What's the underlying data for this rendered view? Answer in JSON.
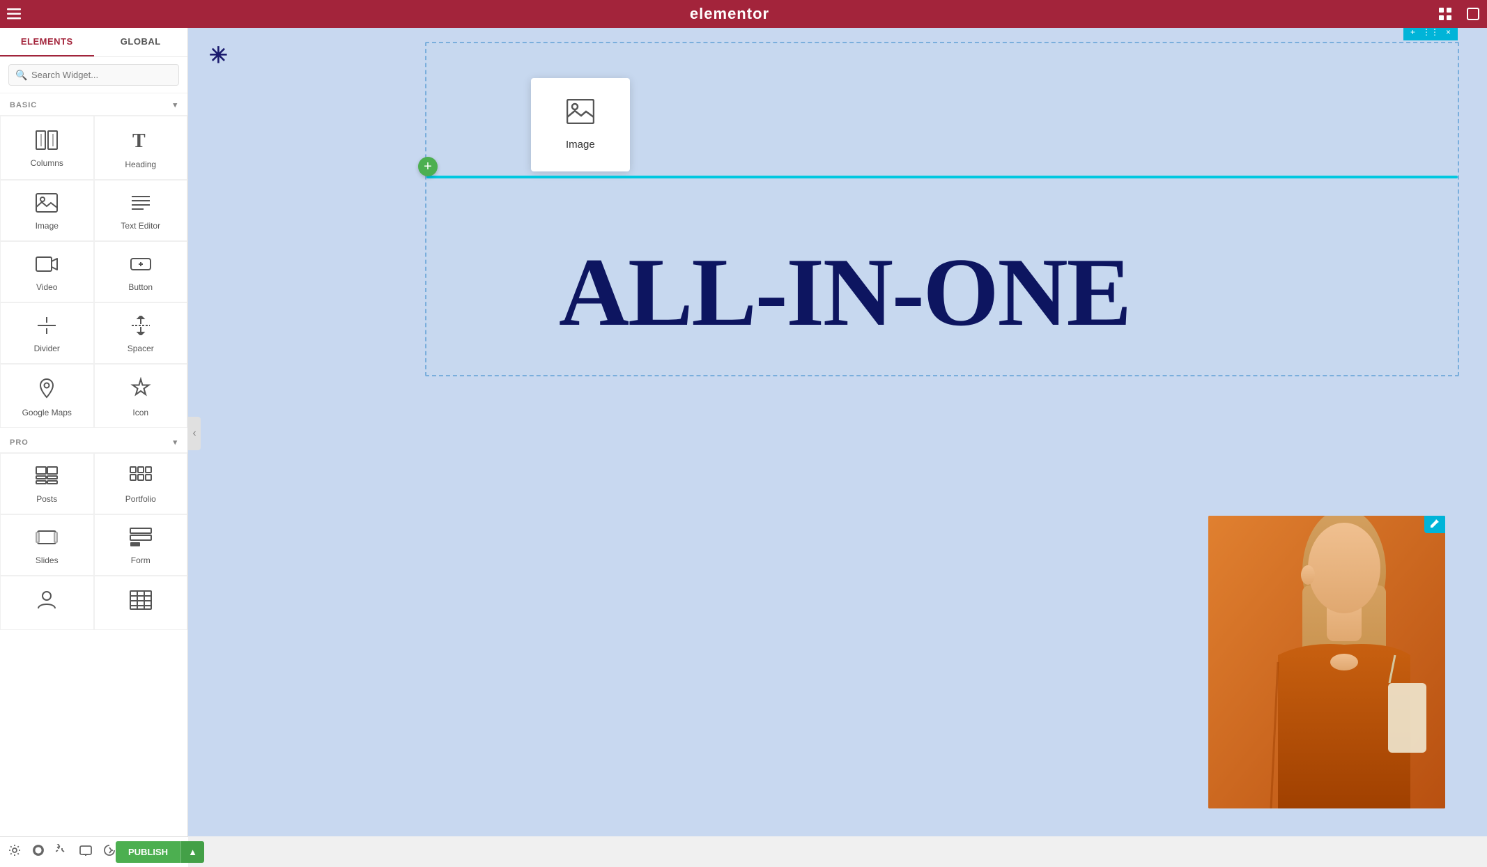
{
  "topbar": {
    "logo": "elementor",
    "hamburger_icon": "☰",
    "grid_icon": "⋮⋮",
    "window_icon": "⊡"
  },
  "sidebar": {
    "tab_elements": "ELEMENTS",
    "tab_global": "GLOBAL",
    "search_placeholder": "Search Widget...",
    "basic_section": "BASIC",
    "pro_section": "PRO",
    "widgets_basic": [
      {
        "id": "columns",
        "label": "Columns",
        "icon": "columns"
      },
      {
        "id": "heading",
        "label": "Heading",
        "icon": "heading"
      },
      {
        "id": "image",
        "label": "Image",
        "icon": "image"
      },
      {
        "id": "text-editor",
        "label": "Text Editor",
        "icon": "text"
      },
      {
        "id": "video",
        "label": "Video",
        "icon": "video"
      },
      {
        "id": "button",
        "label": "Button",
        "icon": "button"
      },
      {
        "id": "divider",
        "label": "Divider",
        "icon": "divider"
      },
      {
        "id": "spacer",
        "label": "Spacer",
        "icon": "spacer"
      },
      {
        "id": "google-maps",
        "label": "Google Maps",
        "icon": "maps"
      },
      {
        "id": "icon",
        "label": "Icon",
        "icon": "icon"
      }
    ],
    "widgets_pro": [
      {
        "id": "posts",
        "label": "Posts",
        "icon": "posts"
      },
      {
        "id": "portfolio",
        "label": "Portfolio",
        "icon": "portfolio"
      },
      {
        "id": "slides",
        "label": "Slides",
        "icon": "slides"
      },
      {
        "id": "form",
        "label": "Form",
        "icon": "form"
      },
      {
        "id": "person",
        "label": "",
        "icon": "person"
      },
      {
        "id": "table",
        "label": "",
        "icon": "table"
      }
    ]
  },
  "bottombar": {
    "settings_icon": "⚙",
    "theme_icon": "◑",
    "history_icon": "↺",
    "preview_icon": "◻",
    "responsive_icon": "👁",
    "publish_label": "PUBLISH",
    "publish_arrow": "▲"
  },
  "canvas": {
    "asterisk": "✳",
    "section_toolbar_plus": "+",
    "section_toolbar_move": "⋮⋮",
    "section_toolbar_close": "×",
    "image_widget_label": "Image",
    "hero_text": "ALL-IN-ONE",
    "add_btn": "+",
    "edit_icon": "✏"
  },
  "colors": {
    "topbar_bg": "#a3243b",
    "accent_green": "#4caf50",
    "accent_cyan": "#00b4d8",
    "hero_text_color": "#0d1560",
    "canvas_bg": "#c8d8f0"
  }
}
